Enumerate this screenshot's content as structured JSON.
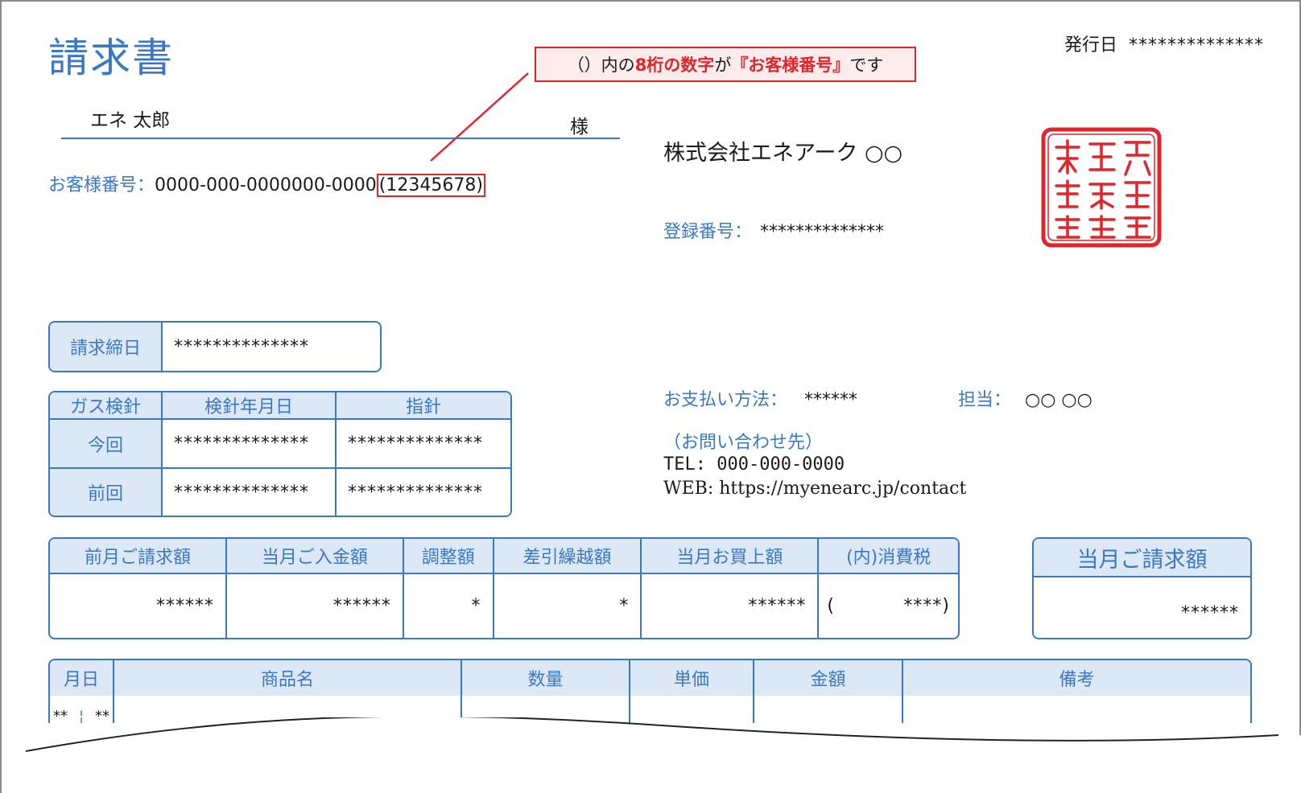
{
  "title": "請求書",
  "issue": {
    "label": "発行日",
    "value": "**************"
  },
  "callout": {
    "p1": "（）内の",
    "p2": "8桁の数字",
    "p3": "が",
    "p4": "『お客様番号』",
    "p5": "です"
  },
  "customer": {
    "name": "エネ 太郎",
    "honorific": "様",
    "number_label": "お客様番号：",
    "number": "0000-000-0000000-0000",
    "number_highlight": "(12345678)"
  },
  "company": {
    "name": "株式会社エネアーク ○○",
    "reg_label": "登録番号：",
    "reg_value": "**************"
  },
  "payment": {
    "label": "お支払い方法：",
    "value": "******",
    "staff_label": "担当：",
    "staff_value": "○○ ○○"
  },
  "contact": {
    "heading": "（お問い合わせ先）",
    "tel": "TEL: 000-000-0000",
    "web": "WEB: https://myenearc.jp/contact"
  },
  "closing": {
    "label": "請求締日",
    "value": "**************"
  },
  "meter": {
    "headers": [
      "ガス検針",
      "検針年月日",
      "指針"
    ],
    "rows": [
      {
        "label": "今回",
        "date": "**************",
        "reading": "**************"
      },
      {
        "label": "前回",
        "date": "**************",
        "reading": "**************"
      }
    ]
  },
  "amounts": {
    "headers": [
      "前月ご請求額",
      "当月ご入金額",
      "調整額",
      "差引繰越額",
      "当月お買上額",
      "(内)消費税"
    ],
    "values": [
      "******",
      "******",
      "*",
      "*",
      "******",
      "****"
    ],
    "tax_open": "(",
    "tax_close": ")"
  },
  "total": {
    "label": "当月ご請求額",
    "value": "******"
  },
  "items": {
    "headers": [
      "月日",
      "商品名",
      "数量",
      "単価",
      "金額",
      "備考"
    ],
    "first_row": {
      "month": "**",
      "day": "**"
    }
  },
  "stamp": {
    "text": "株式会社エネアーク之印",
    "color": "#e0262c"
  },
  "colors": {
    "accent": "#3a78c6",
    "header_bg": "#dde8f7",
    "highlight": "#e0262c"
  }
}
